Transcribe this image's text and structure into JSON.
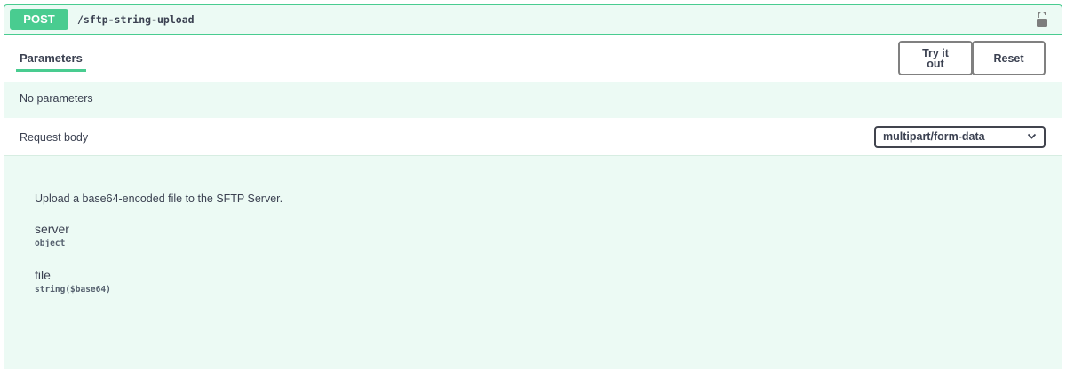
{
  "operation": {
    "method": "POST",
    "path": "/sftp-string-upload"
  },
  "parameters": {
    "tab_label": "Parameters",
    "try_it_out_label": "Try it out",
    "reset_label": "Reset",
    "empty_text": "No parameters"
  },
  "request_body": {
    "title": "Request body",
    "content_type": "multipart/form-data",
    "description": "Upload a base64-encoded file to the SFTP Server.",
    "properties": [
      {
        "name": "server",
        "type": "object"
      },
      {
        "name": "file",
        "type": "string($base64)"
      }
    ]
  },
  "icons": {
    "lock": "unlocked-padlock-icon",
    "select_arrow": "chevron-down-icon"
  },
  "colors": {
    "post_accent": "#49cc90",
    "post_background": "#e8f6f0",
    "text": "#3b4151"
  }
}
